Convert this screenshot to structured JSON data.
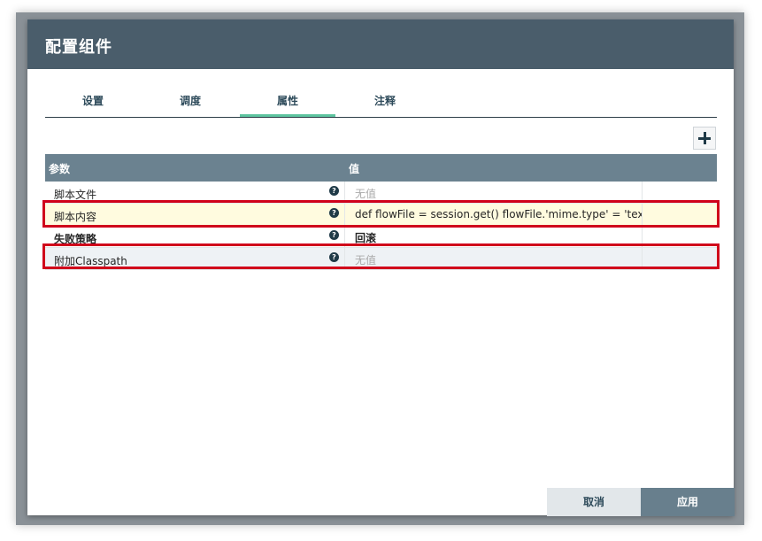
{
  "dialog": {
    "title": "配置组件"
  },
  "tabs": [
    {
      "label": "设置"
    },
    {
      "label": "调度"
    },
    {
      "label": "属性"
    },
    {
      "label": "注释"
    }
  ],
  "active_tab": "属性",
  "table": {
    "headers": {
      "name": "参数",
      "value": "值"
    },
    "rows": [
      {
        "name": "脚本文件",
        "value": "无值",
        "placeholder": true,
        "bold": false
      },
      {
        "name": "脚本内容",
        "value": "def flowFile = session.get() flowFile.'mime.type' = 'text/xml' ...",
        "placeholder": false,
        "bold": false
      },
      {
        "name": "失败策略",
        "value": "回滚",
        "placeholder": false,
        "bold": true
      },
      {
        "name": "附加Classpath",
        "value": "无值",
        "placeholder": true,
        "bold": false
      }
    ]
  },
  "help_icon": "question-circle-icon",
  "add_icon": "plus-icon",
  "buttons": {
    "cancel": "取消",
    "apply": "应用"
  },
  "colors": {
    "header_bg": "#4a5d6b",
    "table_header_bg": "#6b8290",
    "active_tab_underline": "#5dc49f",
    "highlight_box": "#d0021b",
    "apply_bg": "#687f8d"
  }
}
